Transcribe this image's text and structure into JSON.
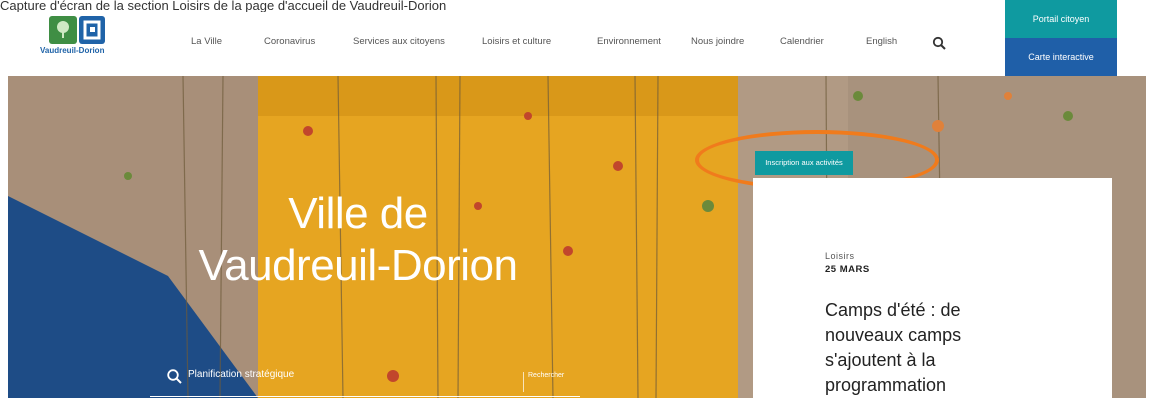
{
  "caption": "Capture d'écran de la section Loisirs de la page d'accueil de Vaudreuil-Dorion",
  "header": {
    "logo_text": "Vaudreuil-Dorion",
    "nav": [
      "La Ville",
      "Coronavirus",
      "Services aux citoyens",
      "Loisirs et culture",
      "Environnement",
      "Nous joindre",
      "Calendrier",
      "English"
    ],
    "search_icon": "search-icon",
    "portal_label": "Portail citoyen",
    "carte_label": "Carte interactive"
  },
  "hero": {
    "title_line1": "Ville de",
    "title_line2": "Vaudreuil-Dorion",
    "search": {
      "placeholder": "Planification stratégique",
      "button": "Rechercher"
    }
  },
  "news": {
    "tag": "Inscription aux activités",
    "category": "Loisirs",
    "date": "25 MARS",
    "headline": "Camps d'été : de nouveaux camps s'ajoutent à la programmation"
  },
  "colors": {
    "teal": "#0f9aa0",
    "blue": "#1f5fa8",
    "highlight": "#f07b1c"
  }
}
